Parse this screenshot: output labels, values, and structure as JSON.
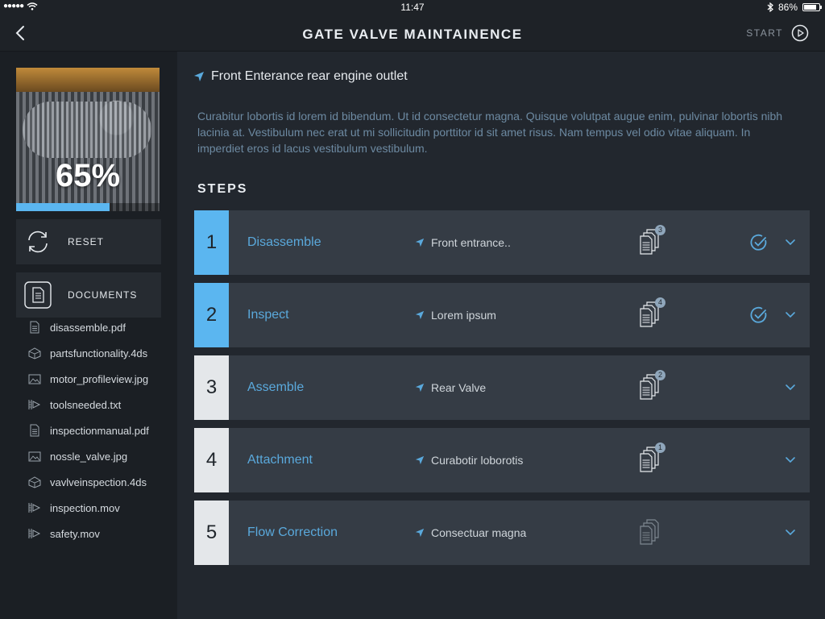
{
  "status_bar": {
    "signal": "●●●●●",
    "time": "11:47",
    "battery_text": "86%",
    "battery_level": 0.86
  },
  "nav": {
    "title": "GATE VALVE MAINTAINENCE",
    "start_label": "START",
    "back_icon": "chevron-left-icon",
    "start_icon": "play-circle-icon"
  },
  "sidebar": {
    "progress_text": "65%",
    "progress_value": 0.65,
    "reset_label": "RESET",
    "documents_label": "DOCUMENTS",
    "documents": [
      {
        "name": "disassemble.pdf",
        "icon": "document-icon"
      },
      {
        "name": "partsfunctionality.4ds",
        "icon": "model-icon"
      },
      {
        "name": "motor_profileview.jpg",
        "icon": "image-icon"
      },
      {
        "name": "toolsneeded.txt",
        "icon": "video-icon"
      },
      {
        "name": "inspectionmanual.pdf",
        "icon": "document-icon"
      },
      {
        "name": "nossle_valve.jpg",
        "icon": "image-icon"
      },
      {
        "name": "vavlveinspection.4ds",
        "icon": "model-icon"
      },
      {
        "name": "inspection.mov",
        "icon": "video-icon"
      },
      {
        "name": "safety.mov",
        "icon": "video-icon"
      }
    ]
  },
  "main": {
    "location": "Front Enterance rear engine outlet",
    "description": "Curabitur lobortis id lorem id bibendum. Ut id consectetur magna. Quisque volutpat augue enim, pulvinar lobortis nibh lacinia at. Vestibulum nec erat ut mi sollicitudin porttitor id sit amet risus. Nam tempus vel odio vitae aliquam. In imperdiet eros id lacus vestibulum vestibulum.",
    "steps_heading": "STEPS",
    "steps": [
      {
        "number": "1",
        "name": "Disassemble",
        "location": "Front entrance..",
        "doc_count": "3",
        "completed": true
      },
      {
        "number": "2",
        "name": "Inspect",
        "location": "Lorem ipsum",
        "doc_count": "4",
        "completed": true
      },
      {
        "number": "3",
        "name": "Assemble",
        "location": "Rear Valve",
        "doc_count": "2",
        "completed": false
      },
      {
        "number": "4",
        "name": "Attachment",
        "location": "Curabotir loborotis",
        "doc_count": "1",
        "completed": false
      },
      {
        "number": "5",
        "name": "Flow Correction",
        "location": "Consectuar magna",
        "doc_count": "",
        "completed": false
      }
    ]
  },
  "colors": {
    "accent": "#5bb6f0",
    "link": "#5aa9dc",
    "step_bg": "#353c45",
    "step_num_done": "#5bb6f0",
    "step_num_pending": "#e4e7ea"
  }
}
